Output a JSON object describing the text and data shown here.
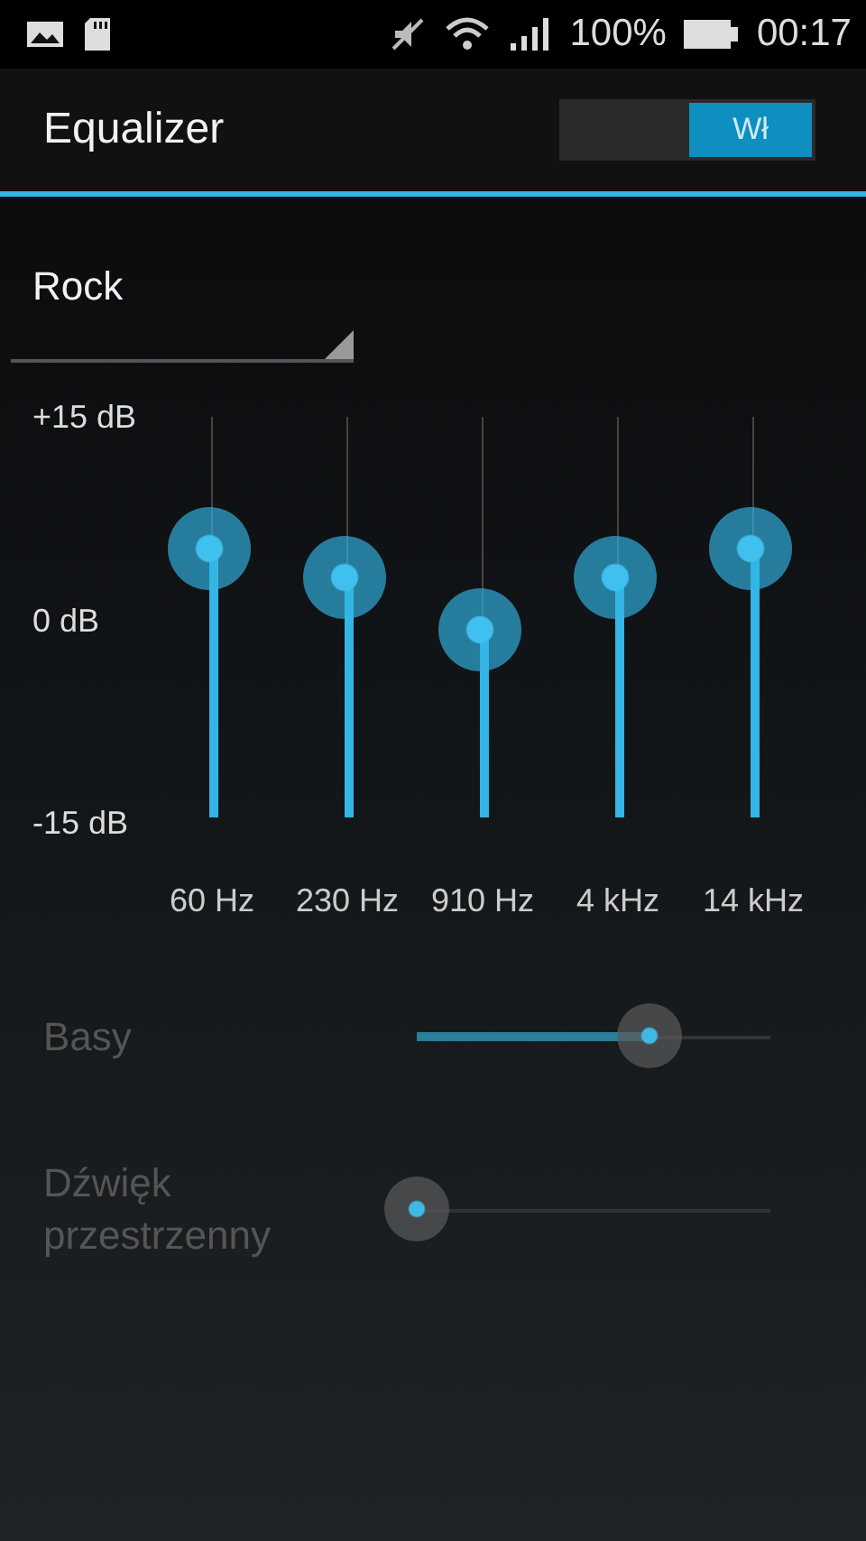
{
  "status_bar": {
    "battery": "100%",
    "time": "00:17"
  },
  "header": {
    "title": "Equalizer",
    "switch": {
      "label": "Wł",
      "on": true
    }
  },
  "preset": {
    "value": "Rock"
  },
  "equalizer": {
    "scale": [
      "+15 dB",
      "0 dB",
      "-15 dB"
    ],
    "bands": [
      {
        "label": "60 Hz",
        "level": 0.67
      },
      {
        "label": "230 Hz",
        "level": 0.6
      },
      {
        "label": "910 Hz",
        "level": 0.47
      },
      {
        "label": "4 kHz",
        "level": 0.6
      },
      {
        "label": "14 kHz",
        "level": 0.67
      }
    ]
  },
  "effects": [
    {
      "label": "Basy",
      "level": 0.66,
      "disabled": true
    },
    {
      "label": "Dźwięk przestrzenny",
      "level": 0,
      "disabled": true
    }
  ]
}
